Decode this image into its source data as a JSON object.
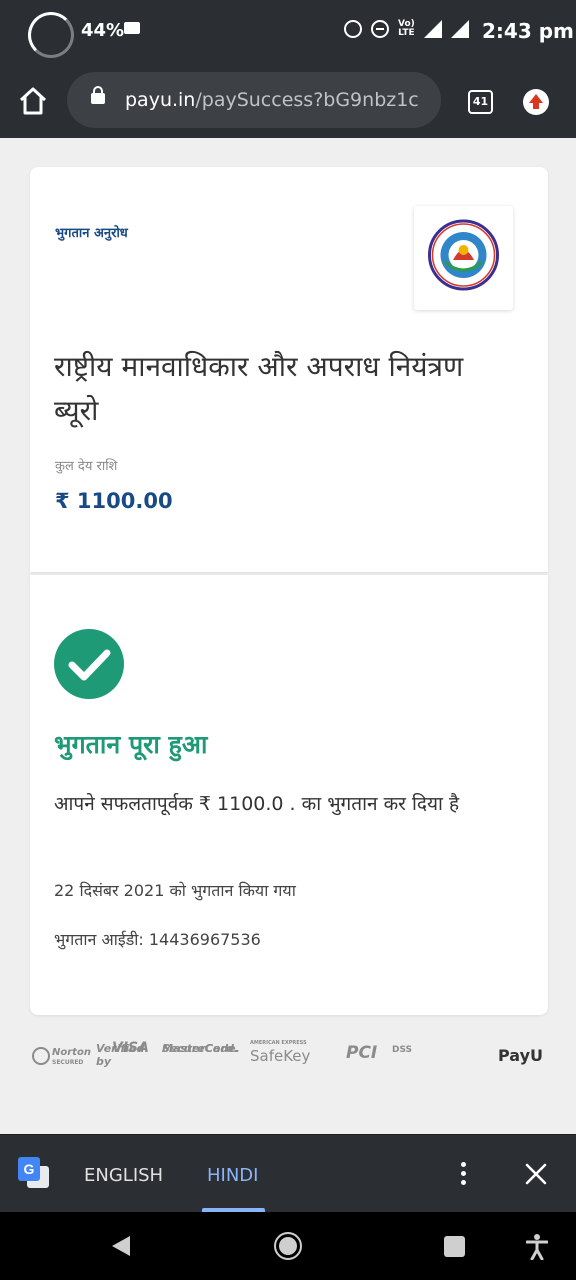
{
  "status_bar": {
    "battery": "44%",
    "time": "2:43 pm",
    "icons": [
      "battery-ring-icon",
      "mail-icon",
      "alarm-icon",
      "dnd-icon",
      "volte-icon",
      "signal-icon",
      "3g-signal-icon"
    ]
  },
  "browser": {
    "url_domain": "payu.in",
    "url_path": "/paySuccess?bG9nbz1c",
    "tab_count": "41"
  },
  "request": {
    "label": "भुगतान अनुरोध",
    "merchant_name": "राष्ट्रीय मानवाधिकार और अपराध नियंत्रण ब्यूरो",
    "amount_label": "कुल देय राशि",
    "amount": "₹ 1100.00"
  },
  "success": {
    "title": "भुगतान पूरा हुआ",
    "message": "आपने सफलतापूर्वक ₹ 1100.0 . का भुगतान कर दिया है",
    "paid_date": "22 दिसंबर 2021 को भुगतान किया गया",
    "payment_id": "भुगतान आईडी: 14436967536",
    "accent": "#1f9a77"
  },
  "trust_badges": {
    "norton": "Norton",
    "norton_sub": "SECURED",
    "visa_top": "Verified by",
    "visa_bottom": "VISA",
    "mastercard_top": "MasterCard.",
    "mastercard_bottom": "SecureCode.",
    "amex_top": "AMERICAN EXPRESS",
    "amex_bottom": "SafeKey",
    "pci": "PCI",
    "pci_dss": "DSS",
    "payu": "PayU"
  },
  "translate": {
    "tab_english": "ENGLISH",
    "tab_hindi": "HINDI",
    "selected": "HINDI",
    "accent": "#8ab4f8"
  }
}
